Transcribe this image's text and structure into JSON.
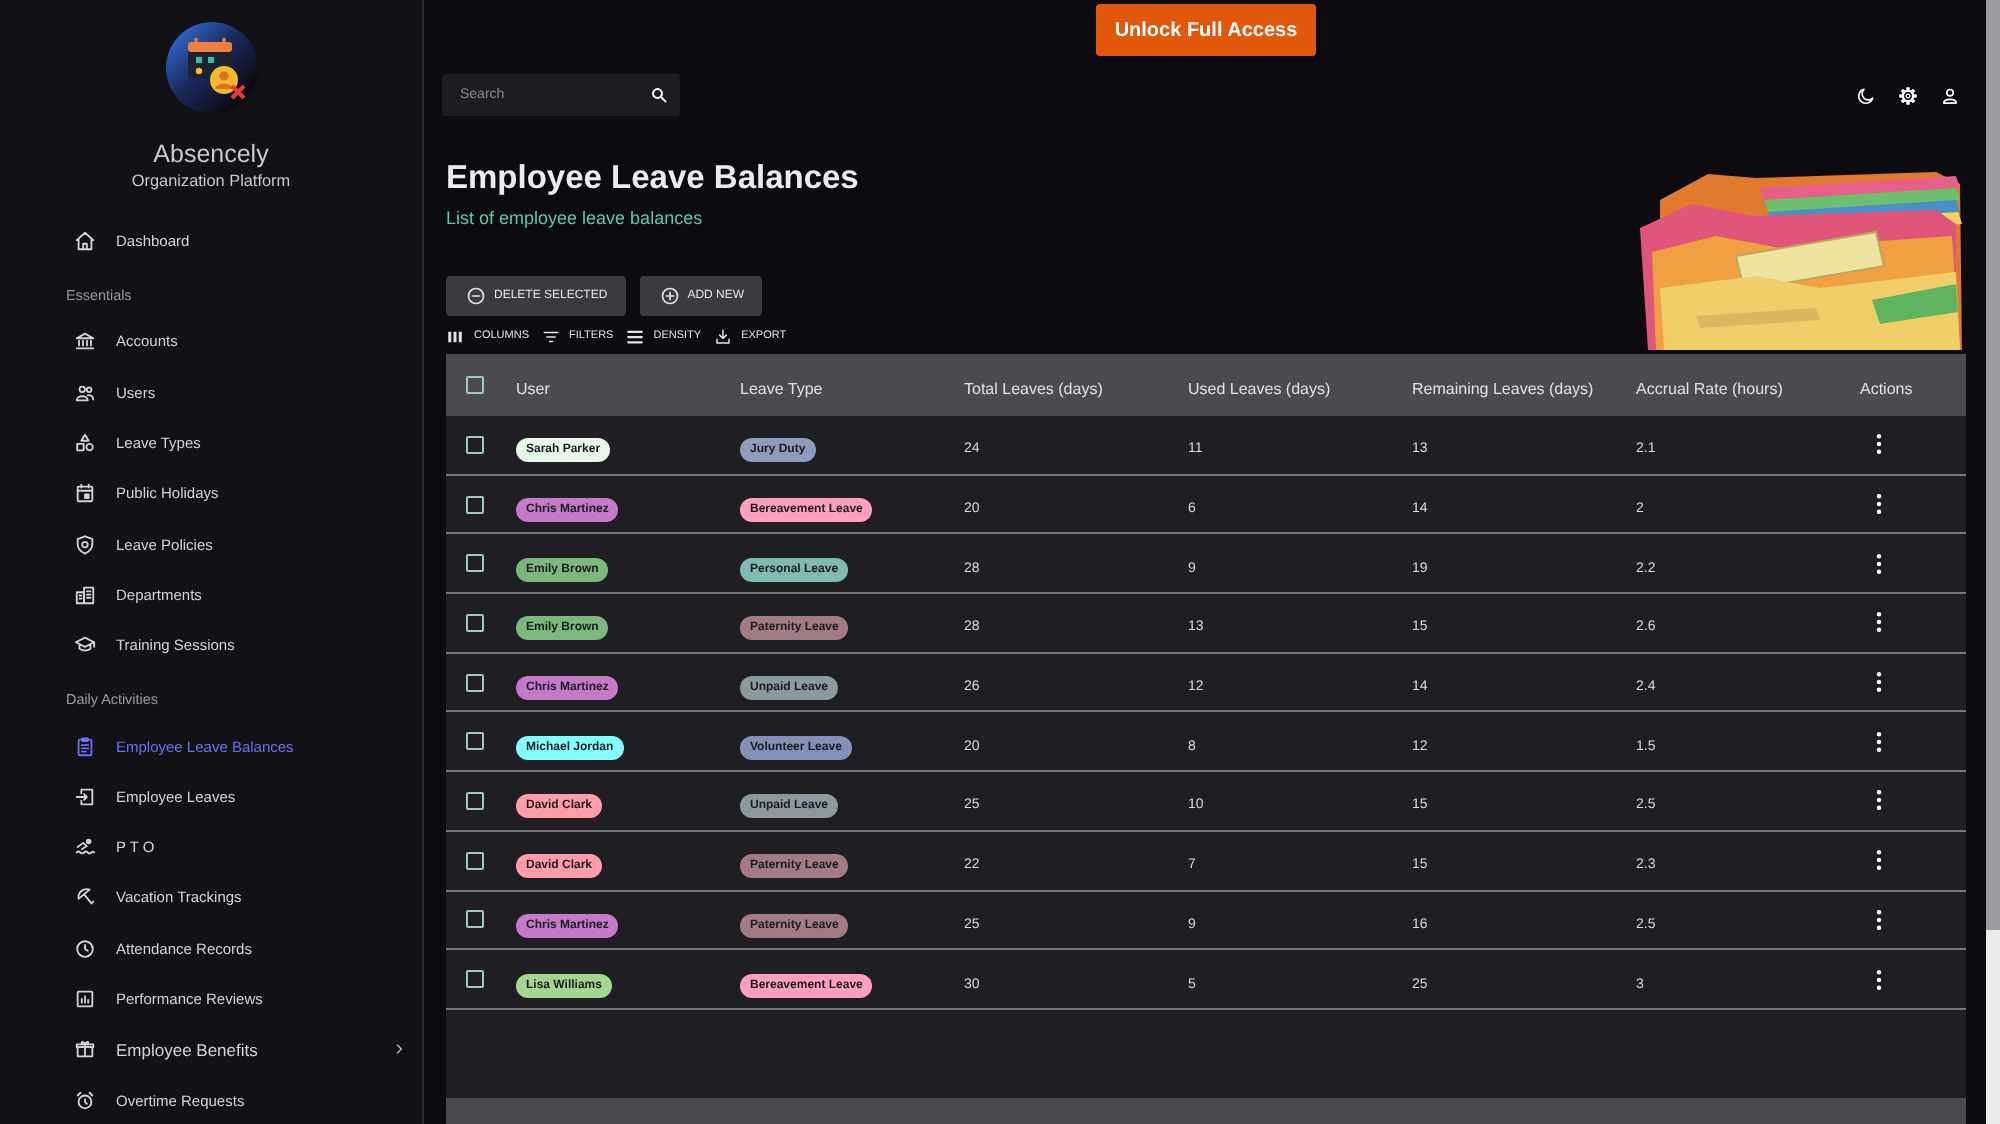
{
  "top_banner": {
    "button": "Unlock Full Access"
  },
  "sidebar": {
    "brand": {
      "name": "Absencely",
      "tagline": "Organization Platform"
    },
    "sections": [
      {
        "items": [
          {
            "label": "Dashboard",
            "kind": "link",
            "selected": false
          }
        ]
      },
      {
        "heading": "Essentials",
        "items": [
          {
            "label": "Accounts",
            "kind": "link",
            "selected": false
          },
          {
            "label": "Users",
            "kind": "link",
            "selected": false
          },
          {
            "label": "Leave Types",
            "kind": "link",
            "selected": false
          },
          {
            "label": "Public Holidays",
            "kind": "link",
            "selected": false
          },
          {
            "label": "Leave Policies",
            "kind": "link",
            "selected": false
          },
          {
            "label": "Departments",
            "kind": "link",
            "selected": false
          },
          {
            "label": "Training Sessions",
            "kind": "link",
            "selected": false
          }
        ]
      },
      {
        "heading": "Daily Activities",
        "items": [
          {
            "label": "Employee Leave Balances",
            "kind": "link",
            "selected": true
          },
          {
            "label": "Employee Leaves",
            "kind": "link",
            "selected": false
          },
          {
            "label": "P T O",
            "kind": "link",
            "selected": false
          },
          {
            "label": "Vacation Trackings",
            "kind": "link",
            "selected": false
          },
          {
            "label": "Attendance Records",
            "kind": "link",
            "selected": false
          },
          {
            "label": "Performance Reviews",
            "kind": "link",
            "selected": false
          },
          {
            "label": "Employee Benefits",
            "kind": "group",
            "selected": false
          },
          {
            "label": "Overtime Requests",
            "kind": "link",
            "selected": false
          }
        ]
      }
    ]
  },
  "toolbar": {
    "search": {
      "placeholder": "Search"
    }
  },
  "page": {
    "title": "Employee Leave Balances",
    "subtitle": "List of employee leave balances",
    "actions": [
      "DELETE SELECTED",
      "ADD NEW"
    ],
    "grid_tools": [
      "COLUMNS",
      "FILTERS",
      "DENSITY",
      "EXPORT"
    ]
  },
  "table": {
    "select_all": {
      "checked": false
    },
    "columns": [
      "User",
      "Leave Type",
      "Total Leaves (days)",
      "Used Leaves (days)",
      "Remaining Leaves (days)",
      "Accrual Rate (hours)",
      "Actions"
    ],
    "rows": [
      {
        "checked": false,
        "user": {
          "name": "Sarah Parker",
          "color": "#e8f5e9"
        },
        "leave_type": {
          "name": "Jury Duty",
          "color": "#8f9cbc"
        },
        "total": "24",
        "used": "11",
        "remaining": "13",
        "accrual": "2.1"
      },
      {
        "checked": false,
        "user": {
          "name": "Chris Martinez",
          "color": "#c47ac8"
        },
        "leave_type": {
          "name": "Bereavement Leave",
          "color": "#ff9fc0"
        },
        "total": "20",
        "used": "6",
        "remaining": "14",
        "accrual": "2"
      },
      {
        "checked": false,
        "user": {
          "name": "Emily Brown",
          "color": "#7cb87c"
        },
        "leave_type": {
          "name": "Personal Leave",
          "color": "#7fbab3"
        },
        "total": "28",
        "used": "9",
        "remaining": "19",
        "accrual": "2.2"
      },
      {
        "checked": false,
        "user": {
          "name": "Emily Brown",
          "color": "#7cb87c"
        },
        "leave_type": {
          "name": "Paternity Leave",
          "color": "#a37b85"
        },
        "total": "28",
        "used": "13",
        "remaining": "15",
        "accrual": "2.6"
      },
      {
        "checked": false,
        "user": {
          "name": "Chris Martinez",
          "color": "#c47ac8"
        },
        "leave_type": {
          "name": "Unpaid Leave",
          "color": "#8c999e"
        },
        "total": "26",
        "used": "12",
        "remaining": "14",
        "accrual": "2.4"
      },
      {
        "checked": false,
        "user": {
          "name": "Michael Jordan",
          "color": "#84ffff"
        },
        "leave_type": {
          "name": "Volunteer Leave",
          "color": "#8490b8"
        },
        "total": "20",
        "used": "8",
        "remaining": "12",
        "accrual": "1.5"
      },
      {
        "checked": false,
        "user": {
          "name": "David Clark",
          "color": "#ff9ea8"
        },
        "leave_type": {
          "name": "Unpaid Leave",
          "color": "#8c999e"
        },
        "total": "25",
        "used": "10",
        "remaining": "15",
        "accrual": "2.5"
      },
      {
        "checked": false,
        "user": {
          "name": "David Clark",
          "color": "#ff9ea8"
        },
        "leave_type": {
          "name": "Paternity Leave",
          "color": "#a37b85"
        },
        "total": "22",
        "used": "7",
        "remaining": "15",
        "accrual": "2.3"
      },
      {
        "checked": false,
        "user": {
          "name": "Chris Martinez",
          "color": "#c47ac8"
        },
        "leave_type": {
          "name": "Paternity Leave",
          "color": "#a37b85"
        },
        "total": "25",
        "used": "9",
        "remaining": "16",
        "accrual": "2.5"
      },
      {
        "checked": false,
        "user": {
          "name": "Lisa Williams",
          "color": "#a5d68f"
        },
        "leave_type": {
          "name": "Bereavement Leave",
          "color": "#ff9fc0"
        },
        "total": "30",
        "used": "5",
        "remaining": "25",
        "accrual": "3"
      }
    ]
  }
}
